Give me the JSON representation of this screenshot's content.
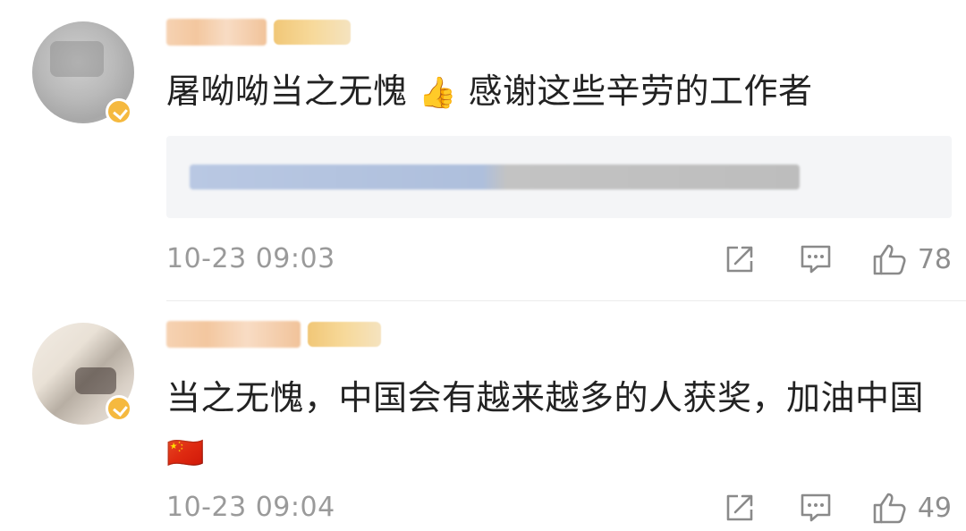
{
  "comments": [
    {
      "text": "屠呦呦当之无愧",
      "emoji": "👍",
      "text_after": "感谢这些辛劳的工作者",
      "time": "10-23 09:03",
      "likes": "78"
    },
    {
      "text": "当之无愧，中国会有越来越多的人获奖，加油中国",
      "emoji": "🇨🇳",
      "time": "10-23 09:04",
      "likes": "49"
    }
  ],
  "icons": {
    "share": "share-icon",
    "reply": "comment-icon",
    "like": "thumbs-up-icon"
  },
  "colors": {
    "text": "#222222",
    "meta": "#9a9a9a",
    "reply_bg": "#f4f5f7",
    "badge": "#f5b93f"
  }
}
